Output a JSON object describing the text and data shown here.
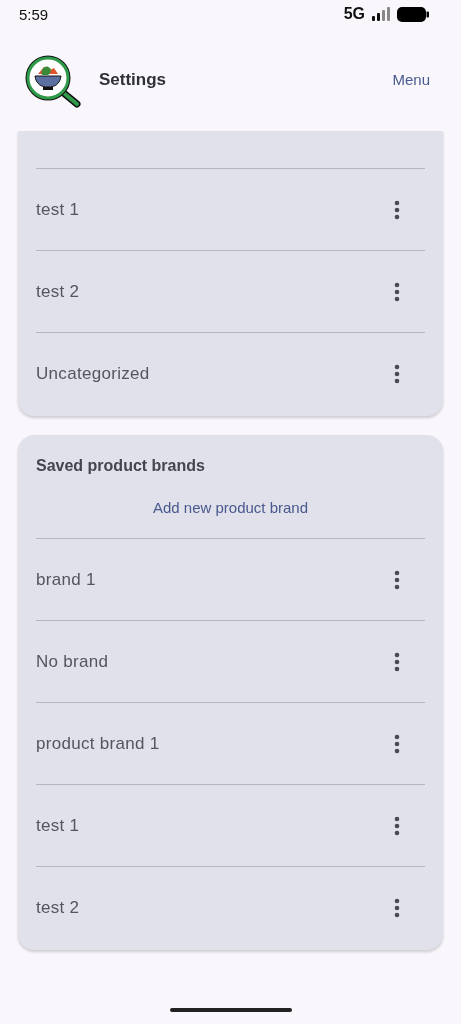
{
  "status_bar": {
    "time": "5:59",
    "network": "5G"
  },
  "app_bar": {
    "title": "Settings",
    "menu": "Menu"
  },
  "categories_card": {
    "items": [
      "test 1",
      "test 2",
      "Uncategorized"
    ]
  },
  "brands_card": {
    "title": "Saved product brands",
    "add_button": "Add new product brand",
    "items": [
      "brand 1",
      "No brand",
      "product brand 1",
      "test 1",
      "test 2"
    ]
  }
}
